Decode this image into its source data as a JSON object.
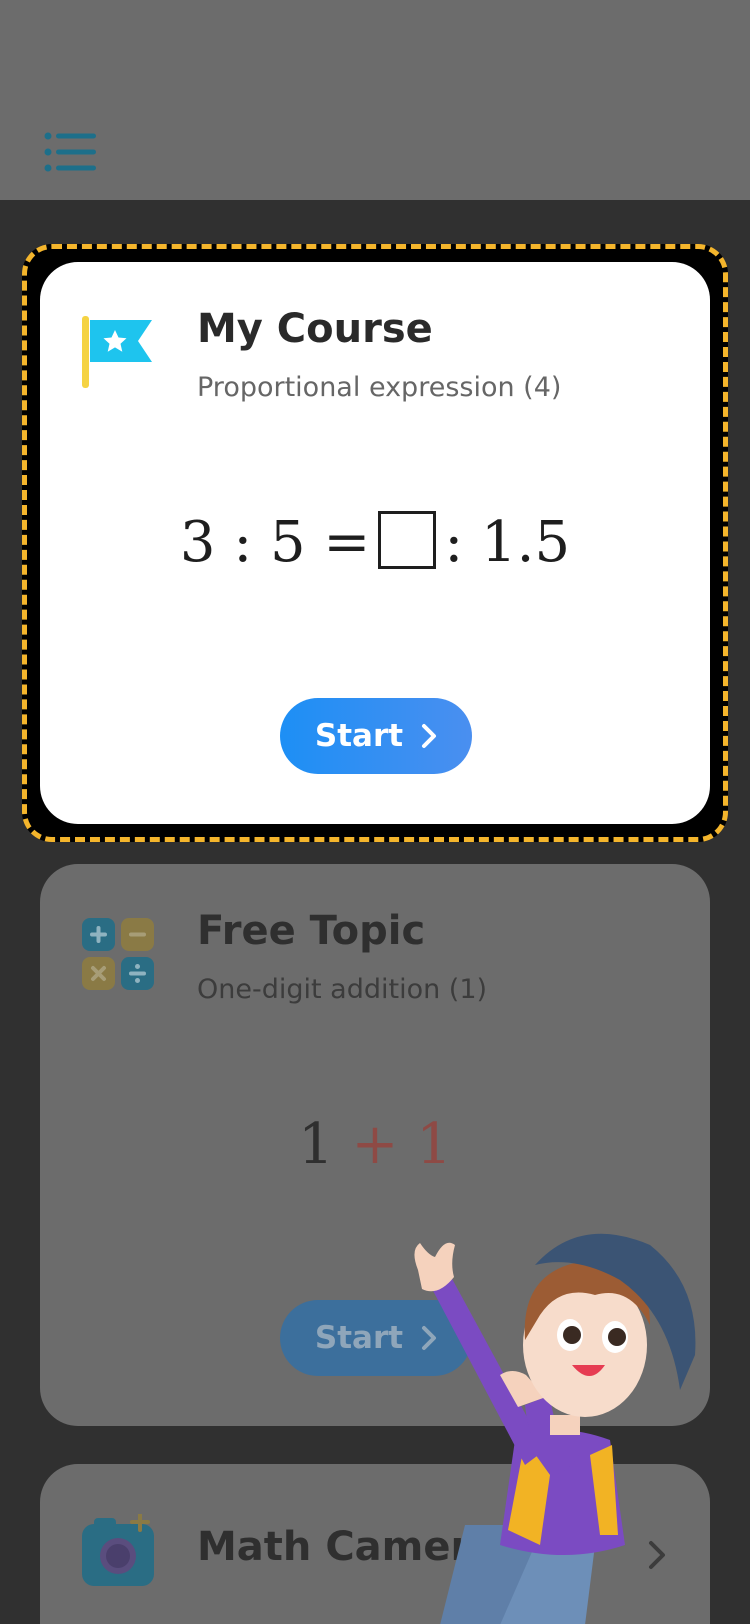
{
  "header": {
    "menu_icon": "list-icon"
  },
  "courses": [
    {
      "title": "My Course",
      "subtitle": "Proportional expression (4)",
      "icon": "flag-star-icon",
      "equation": {
        "left": "3 : 5 =",
        "right": ": 1.5"
      },
      "start_label": "Start"
    },
    {
      "title": "Free Topic",
      "subtitle": "One-digit addition (1)",
      "icon": "calculator-operations-icon",
      "equation": {
        "a": "1",
        "op": "+",
        "b": "1"
      },
      "start_label": "Start"
    }
  ],
  "camera": {
    "title": "Math Camera",
    "icon": "camera-icon"
  },
  "colors": {
    "accent_blue": "#1d8ff5",
    "highlight_dash": "#f4b52c",
    "overlay": "#6c6c6c"
  }
}
